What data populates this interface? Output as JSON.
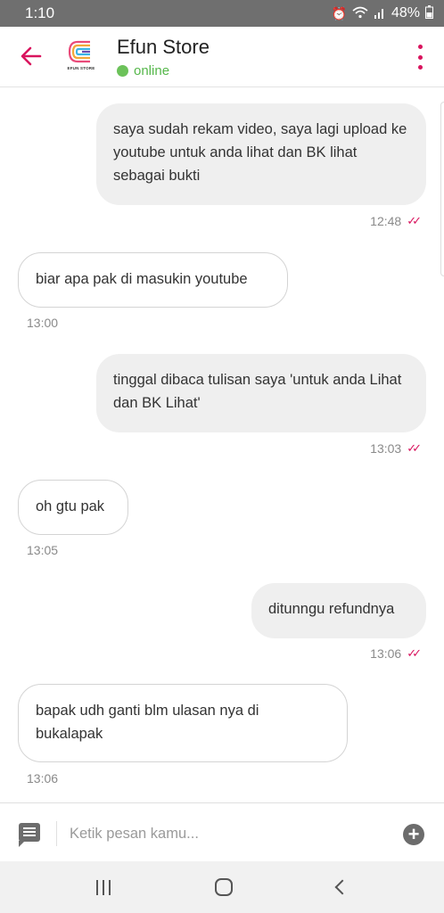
{
  "status_bar": {
    "time": "1:10",
    "battery": "48%",
    "icons": [
      "alarm-icon",
      "wifi-icon",
      "signal-icon",
      "battery-icon"
    ]
  },
  "header": {
    "title": "Efun Store",
    "status": "online",
    "logo_caption": "EFUN STORE",
    "accent_color": "#d9145e",
    "online_color": "#6cc25a"
  },
  "messages": [
    {
      "direction": "out",
      "text": "saya sudah rekam video, saya lagi upload ke youtube untuk anda lihat dan BK lihat sebagai bukti",
      "time": "12:48"
    },
    {
      "direction": "in",
      "text": "biar apa pak di masukin youtube",
      "time": "13:00"
    },
    {
      "direction": "out",
      "text": "tinggal dibaca tulisan saya 'untuk anda Lihat dan BK Lihat'",
      "time": "13:03"
    },
    {
      "direction": "in",
      "text": "oh gtu pak",
      "time": "13:05"
    },
    {
      "direction": "out",
      "text": "ditunngu refundnya",
      "time": "13:06"
    },
    {
      "direction": "in",
      "text": "bapak udh ganti blm ulasan nya di bukalapak",
      "time": "13:06"
    }
  ],
  "input": {
    "placeholder": "Ketik pesan kamu...",
    "value": ""
  }
}
